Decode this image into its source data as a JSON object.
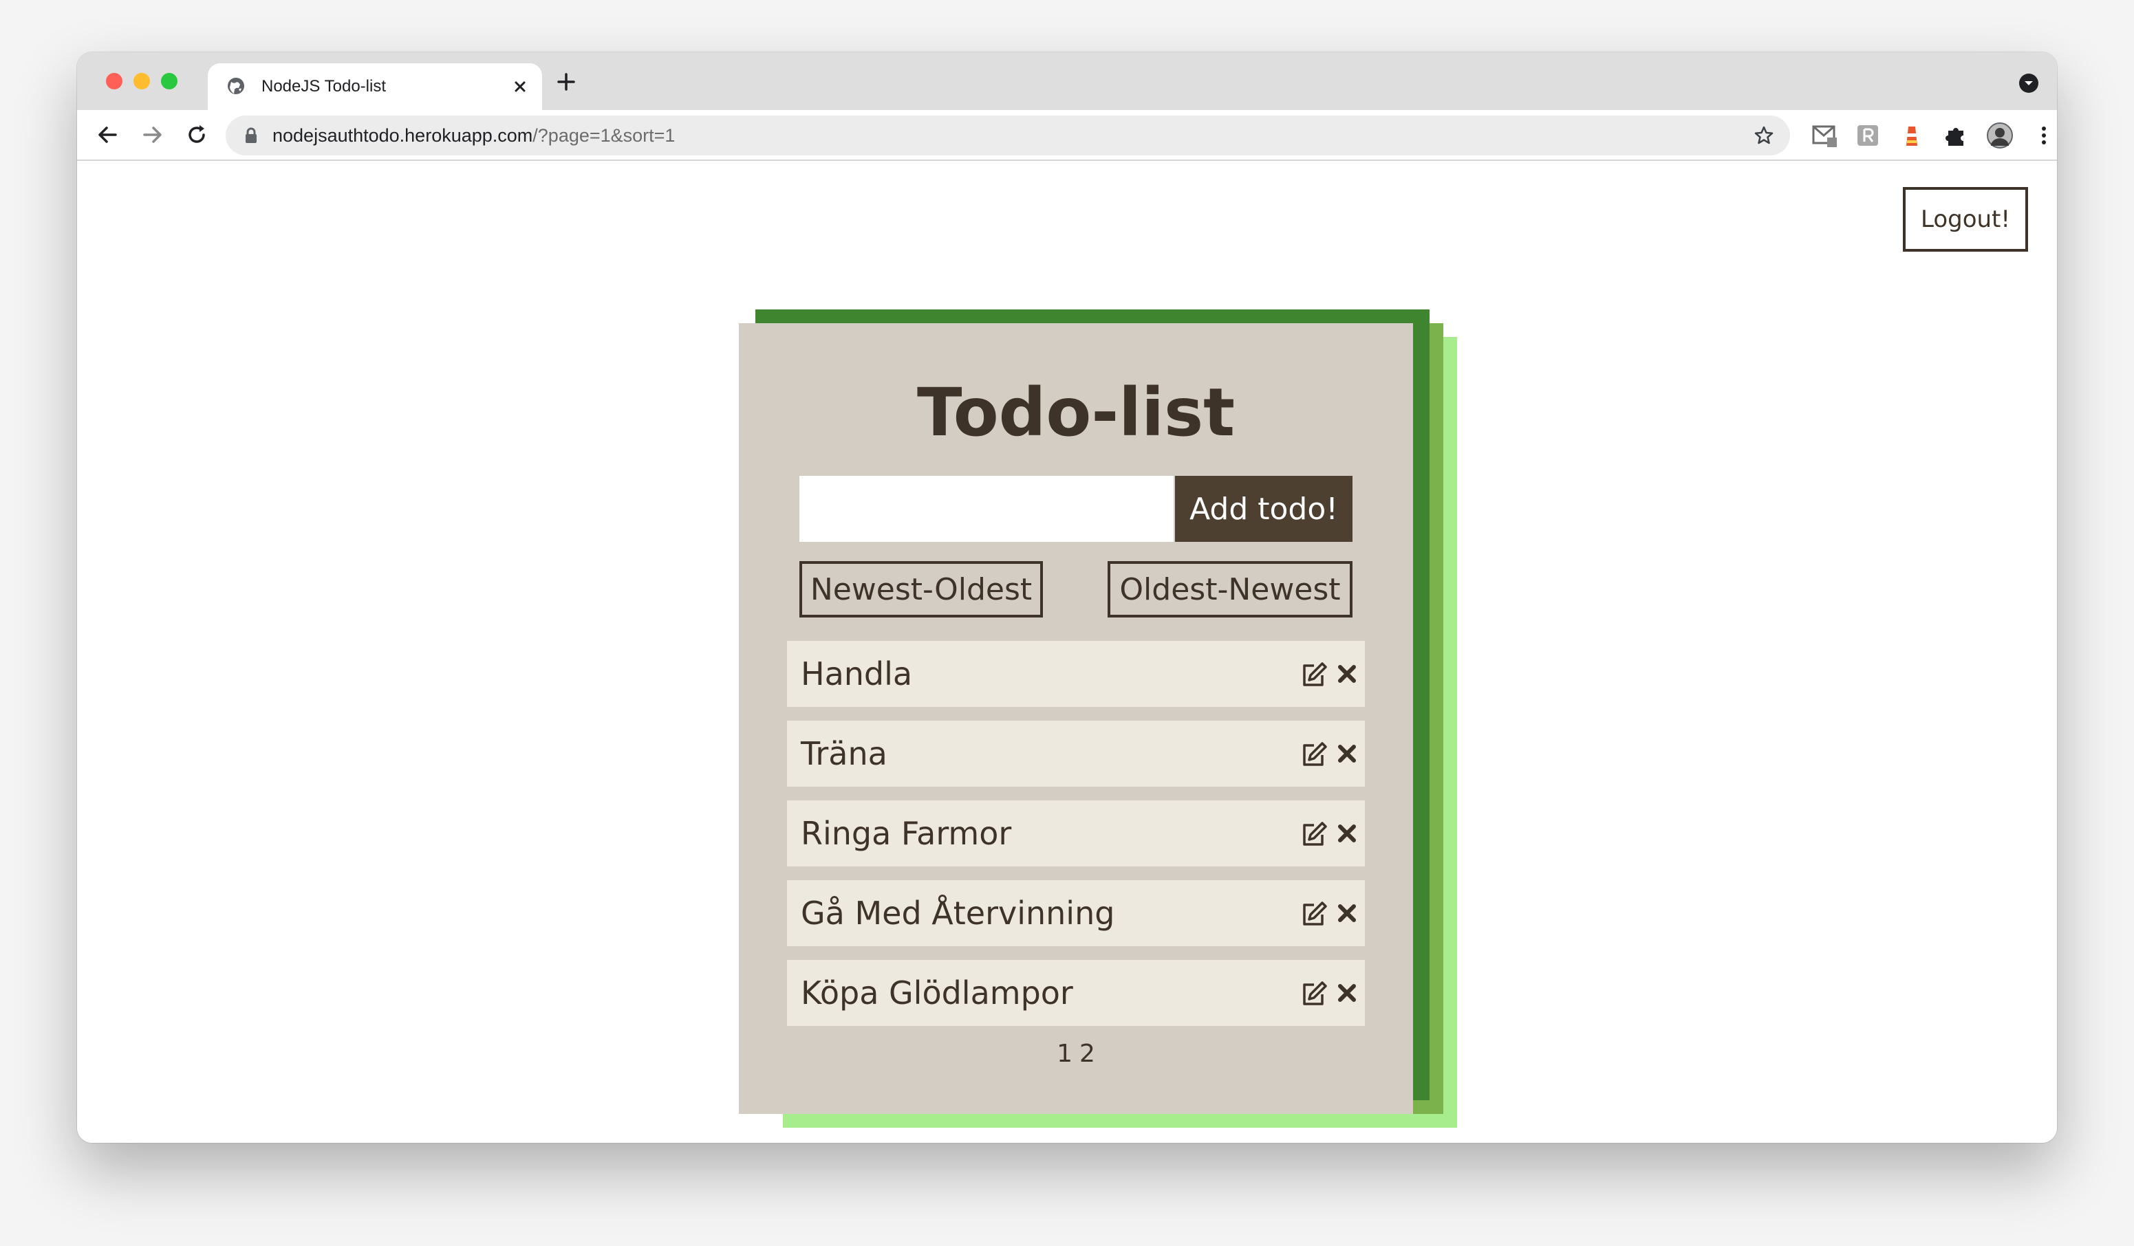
{
  "browser": {
    "tab_title": "NodeJS Todo-list",
    "url_host": "nodejsauthtodo.herokuapp.com",
    "url_path": "/?page=1&sort=1"
  },
  "page": {
    "logout_label": "Logout!",
    "title": "Todo-list",
    "input_value": "",
    "add_label": "Add todo!",
    "sort_newest_label": "Newest-Oldest",
    "sort_oldest_label": "Oldest-Newest",
    "todos": [
      {
        "text": "Handla"
      },
      {
        "text": "Träna"
      },
      {
        "text": "Ringa Farmor"
      },
      {
        "text": "Gå Med Återvinning"
      },
      {
        "text": "Köpa Glödlampor"
      }
    ],
    "pages": [
      "1",
      "2"
    ]
  },
  "colors": {
    "card_bg": "#d4cdc3",
    "item_bg": "#eee9de",
    "text_dark": "#3e3328",
    "button_dark": "#4d4030",
    "shadow_dark_green": "#3f8530",
    "shadow_mid_green": "#7cb24b",
    "shadow_light_green": "#a7ec8d"
  },
  "icons": {
    "edit": "edit-icon",
    "delete": "close-icon"
  }
}
